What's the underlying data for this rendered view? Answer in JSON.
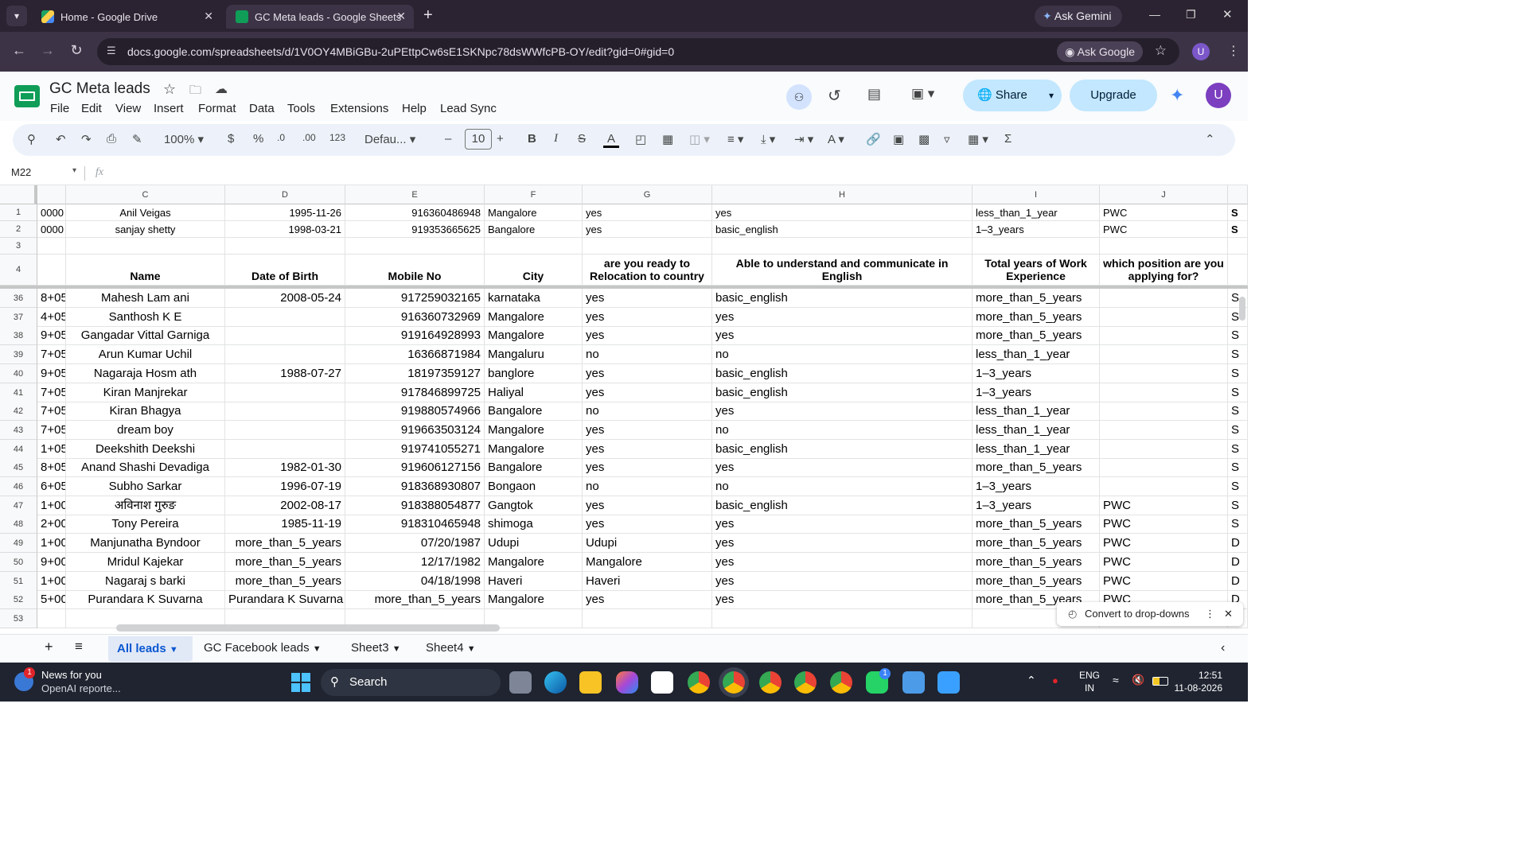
{
  "browser": {
    "tabs": [
      {
        "title": "Home - Google Drive"
      },
      {
        "title": "GC Meta leads - Google Sheets"
      }
    ],
    "ask_gemini": "Ask Gemini",
    "url": "docs.google.com/spreadsheets/d/1V0OY4MBiGBu-2uPEttpCw6sE1SKNpc78dsWWfcPB-OY/edit?gid=0#gid=0",
    "ask_google": "Ask Google",
    "profile_letter": "U"
  },
  "doc": {
    "title": "GC Meta leads",
    "menus": [
      "File",
      "Edit",
      "View",
      "Insert",
      "Format",
      "Data",
      "Tools",
      "Extensions",
      "Help",
      "Lead Sync"
    ],
    "share_label": "Share",
    "upgrade_label": "Upgrade",
    "avatar_letter": "U"
  },
  "toolbar": {
    "zoom": "100%",
    "currency": "$",
    "percent": "%",
    "dec_dec": ".0",
    "inc_dec": ".00",
    "number_format": "123",
    "font": "Defau...",
    "font_size": "10"
  },
  "formula": {
    "cell_ref": "M22",
    "fx": "fx"
  },
  "grid": {
    "columns": [
      {
        "letter": "C"
      },
      {
        "letter": "D"
      },
      {
        "letter": "E"
      },
      {
        "letter": "F"
      },
      {
        "letter": "G"
      },
      {
        "letter": "H"
      },
      {
        "letter": "I"
      },
      {
        "letter": "J"
      }
    ],
    "frozen_rows": [
      {
        "num": "1",
        "b": "0000",
        "c": "Anil  Veigas",
        "d": "1995-11-26",
        "e": "916360486948",
        "f": "Mangalore",
        "g": "yes",
        "h": "yes",
        "i": "less_than_1_year",
        "j": "PWC",
        "k": "S"
      },
      {
        "num": "2",
        "b": "0000",
        "c": "sanjay shetty",
        "d": "1998-03-21",
        "e": "919353665625",
        "f": "Bangalore",
        "g": "yes",
        "h": "basic_english",
        "i": "1–3_years",
        "j": "PWC",
        "k": "S"
      },
      {
        "num": "3",
        "b": "",
        "c": "",
        "d": "",
        "e": "",
        "f": "",
        "g": "",
        "h": "",
        "i": "",
        "j": "",
        "k": ""
      }
    ],
    "header_row": {
      "num": "4",
      "c": "Name",
      "d": "Date of Birth",
      "e": "Mobile No",
      "f": "City",
      "g": "are you ready to Relocation to country",
      "h": "Able to understand and communicate in English",
      "i": "Total years of Work Experience",
      "j": "which position are you applying for?"
    },
    "rows": [
      {
        "num": "36",
        "b": "8+05",
        "c": "Mahesh Lam ani",
        "d": "2008-05-24",
        "e": "917259032165",
        "f": "karnataka",
        "g": "yes",
        "h": "basic_english",
        "i": "more_than_5_years",
        "j": "",
        "k": "S"
      },
      {
        "num": "37",
        "b": "4+05",
        "c": "Santhosh K E",
        "d": "",
        "e": "916360732969",
        "f": "Mangalore",
        "g": "yes",
        "h": "yes",
        "i": "more_than_5_years",
        "j": "",
        "k": "S"
      },
      {
        "num": "38",
        "b": "9+05",
        "c": "Gangadar Vittal Garniga",
        "d": "",
        "e": "919164928993",
        "f": "Mangalore",
        "g": "yes",
        "h": "yes",
        "i": "more_than_5_years",
        "j": "",
        "k": "S"
      },
      {
        "num": "39",
        "b": "7+05",
        "c": "Arun Kumar Uchil",
        "d": "",
        "e": "16366871984",
        "f": "Mangaluru",
        "g": "no",
        "h": "no",
        "i": "less_than_1_year",
        "j": "",
        "k": "S"
      },
      {
        "num": "40",
        "b": "9+05",
        "c": "Nagaraja Hosm ath",
        "d": "1988-07-27",
        "e": "18197359127",
        "f": "banglore",
        "g": "yes",
        "h": "basic_english",
        "i": "1–3_years",
        "j": "",
        "k": "S"
      },
      {
        "num": "41",
        "b": "7+05",
        "c": "Kiran Manjrekar",
        "d": "",
        "e": "917846899725",
        "f": "Haliyal",
        "g": "yes",
        "h": "basic_english",
        "i": "1–3_years",
        "j": "",
        "k": "S"
      },
      {
        "num": "42",
        "b": "7+05",
        "c": "Kiran Bhagya",
        "d": "",
        "e": "919880574966",
        "f": "Bangalore",
        "g": "no",
        "h": "yes",
        "i": "less_than_1_year",
        "j": "",
        "k": "S"
      },
      {
        "num": "43",
        "b": "7+05",
        "c": "dream boy",
        "d": "",
        "e": "919663503124",
        "f": "Mangalore",
        "g": "yes",
        "h": "no",
        "i": "less_than_1_year",
        "j": "",
        "k": "S"
      },
      {
        "num": "44",
        "b": "1+05",
        "c": "Deekshith Deekshi",
        "d": "",
        "e": "919741055271",
        "f": "Mangalore",
        "g": "yes",
        "h": "basic_english",
        "i": "less_than_1_year",
        "j": "",
        "k": "S"
      },
      {
        "num": "45",
        "b": "8+05",
        "c": "Anand Shashi Devadiga",
        "d": "1982-01-30",
        "e": "919606127156",
        "f": "Bangalore",
        "g": "yes",
        "h": "yes",
        "i": "more_than_5_years",
        "j": "",
        "k": "S"
      },
      {
        "num": "46",
        "b": "6+05",
        "c": "Subho Sarkar",
        "d": "1996-07-19",
        "e": "918368930807",
        "f": "Bongaon",
        "g": "no",
        "h": "no",
        "i": "1–3_years",
        "j": "",
        "k": "S"
      },
      {
        "num": "47",
        "b": "1+00",
        "c": "अविनाश गुरुङ",
        "d": "2002-08-17",
        "e": "918388054877",
        "f": "Gangtok",
        "g": "yes",
        "h": "basic_english",
        "i": "1–3_years",
        "j": "PWC",
        "k": "S"
      },
      {
        "num": "48",
        "b": "2+00",
        "c": "Tony Pereira",
        "d": "1985-11-19",
        "e": "918310465948",
        "f": "shimoga",
        "g": "yes",
        "h": "yes",
        "i": "more_than_5_years",
        "j": "PWC",
        "k": "S"
      },
      {
        "num": "49",
        "b": "1+00",
        "c": "Manjunatha Byndoor",
        "d": "more_than_5_years",
        "e": "07/20/1987",
        "f": "Udupi",
        "g": "Udupi",
        "h": "yes",
        "i": "more_than_5_years",
        "j": "PWC",
        "k": "D"
      },
      {
        "num": "50",
        "b": "9+00",
        "c": "Mridul Kajekar",
        "d": "more_than_5_years",
        "e": "12/17/1982",
        "f": "Mangalore",
        "g": "Mangalore",
        "h": "yes",
        "i": "more_than_5_years",
        "j": "PWC",
        "k": "D"
      },
      {
        "num": "51",
        "b": "1+00",
        "c": "Nagaraj s barki",
        "d": "more_than_5_years",
        "e": "04/18/1998",
        "f": "Haveri",
        "g": "Haveri",
        "h": "yes",
        "i": "more_than_5_years",
        "j": "PWC",
        "k": "D"
      },
      {
        "num": "52",
        "b": "5+00",
        "c": "Purandara K Suvarna",
        "d": "Purandara K Suvarna",
        "e": "more_than_5_years",
        "f": "Mangalore",
        "g": "yes",
        "h": "yes",
        "i": "more_than_5_years",
        "j": "PWC",
        "k": "D"
      },
      {
        "num": "53",
        "b": "",
        "c": "",
        "d": "",
        "e": "",
        "f": "",
        "g": "",
        "h": "",
        "i": "",
        "j": "",
        "k": ""
      }
    ]
  },
  "popup": {
    "label": "Convert to drop-downs"
  },
  "sheets": [
    {
      "name": "All leads"
    },
    {
      "name": "GC Facebook leads"
    },
    {
      "name": "Sheet3"
    },
    {
      "name": "Sheet4"
    }
  ],
  "taskbar": {
    "news_title": "News for you",
    "news_sub": "OpenAI reporte...",
    "news_badge": "1",
    "search_label": "Search",
    "lang_top": "ENG",
    "lang_bottom": "IN",
    "time": "12:51",
    "date": "11-08-2026",
    "whatsapp_badge": "1"
  }
}
